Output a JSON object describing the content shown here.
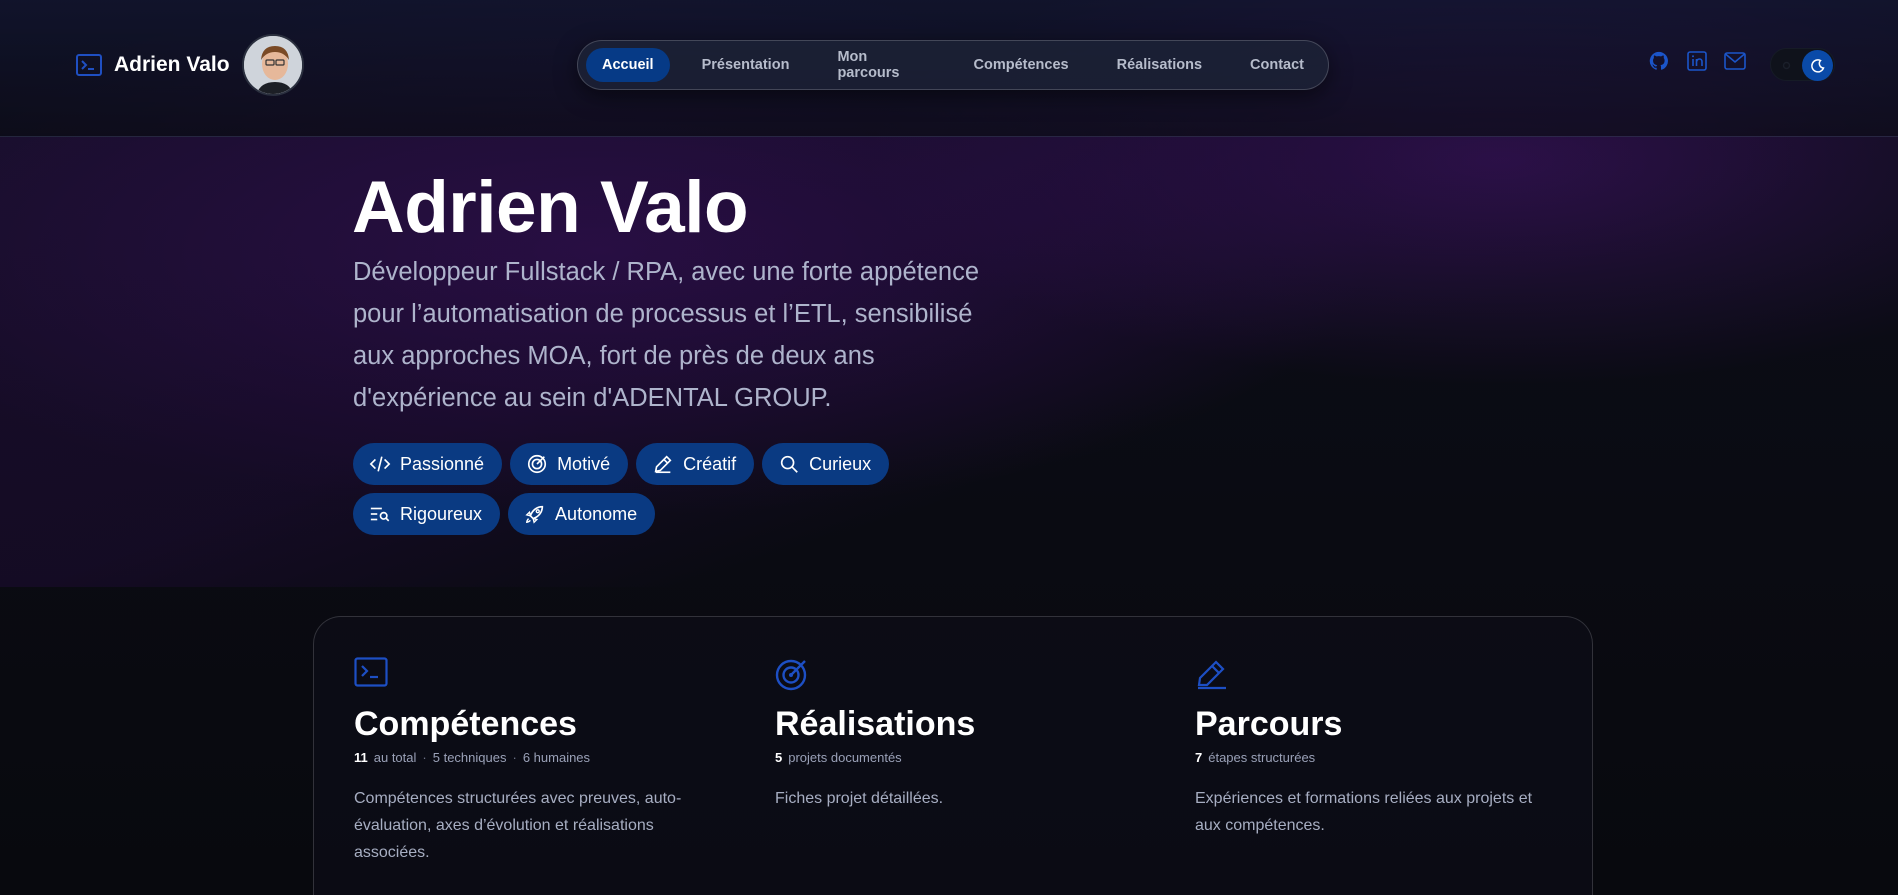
{
  "brand": {
    "name": "Adrien Valo",
    "icon": "terminal-icon"
  },
  "nav": {
    "items": [
      {
        "label": "Accueil",
        "active": true
      },
      {
        "label": "Présentation"
      },
      {
        "label": "Mon parcours"
      },
      {
        "label": "Compétences"
      },
      {
        "label": "Réalisations"
      },
      {
        "label": "Contact"
      }
    ]
  },
  "socials": [
    "github-icon",
    "linkedin-icon",
    "mail-icon"
  ],
  "hero": {
    "title": "Adrien Valo",
    "description": "Développeur Fullstack / RPA, avec une forte appétence pour l’automatisation de processus et l’ETL, sensibilisé aux approches MOA, fort de près de deux ans d'expérience au sein d'ADENTAL GROUP.",
    "tags": [
      {
        "label": "Passionné",
        "icon": "code-icon"
      },
      {
        "label": "Motivé",
        "icon": "target-icon"
      },
      {
        "label": "Créatif",
        "icon": "pencil-icon"
      },
      {
        "label": "Curieux",
        "icon": "search-icon"
      },
      {
        "label": "Rigoureux",
        "icon": "list-search-icon"
      },
      {
        "label": "Autonome",
        "icon": "rocket-icon"
      }
    ]
  },
  "cards": [
    {
      "title": "Compétences",
      "icon": "terminal-icon",
      "meta": [
        {
          "num": "11",
          "text": "au total"
        },
        {
          "text": "5 techniques"
        },
        {
          "text": "6 humaines"
        }
      ],
      "description": "Compétences structurées avec preuves, auto-évaluation, axes d’évolution et réalisations associées."
    },
    {
      "title": "Réalisations",
      "icon": "target-icon",
      "meta": [
        {
          "num": "5",
          "text": "projets documentés"
        }
      ],
      "description": "Fiches projet détaillées."
    },
    {
      "title": "Parcours",
      "icon": "pencil-icon",
      "meta": [
        {
          "num": "7",
          "text": "étapes structurées"
        }
      ],
      "description": "Expériences et formations reliées aux projets et aux compétences."
    }
  ],
  "colors": {
    "accent": "#063a86",
    "icon_blue": "#1a4fc4",
    "background": "#0a0b12"
  }
}
